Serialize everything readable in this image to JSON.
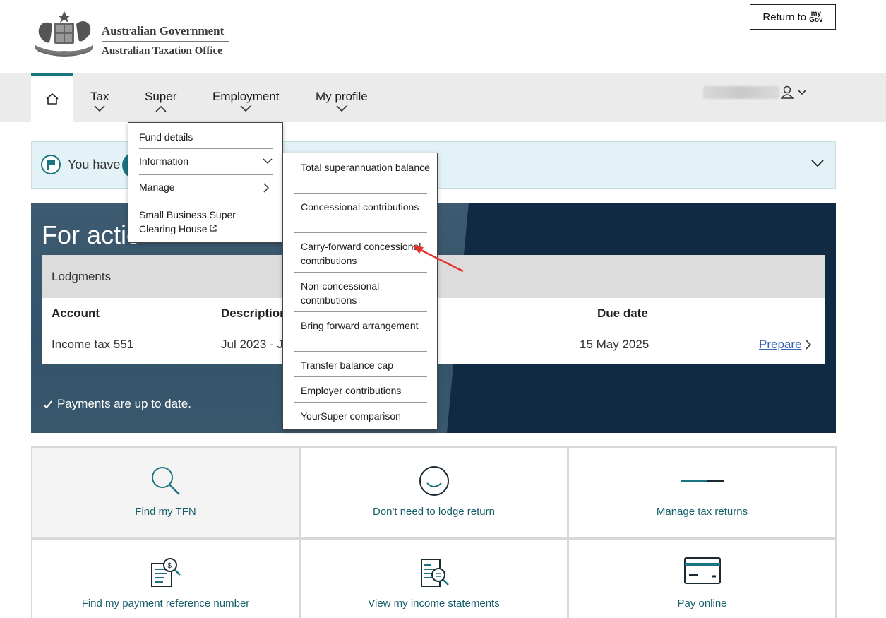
{
  "header": {
    "org_line1": "Australian Government",
    "org_line2": "Australian Taxation Office",
    "return_label": "Return to",
    "mygov_top": "my",
    "mygov_bottom": "Gov"
  },
  "nav": {
    "items": [
      {
        "label": "Tax"
      },
      {
        "label": "Super"
      },
      {
        "label": "Employment"
      },
      {
        "label": "My profile"
      }
    ]
  },
  "notice": {
    "text": "You have"
  },
  "action": {
    "title": "For actio",
    "lodgments_label": "Lodgments",
    "columns": [
      "Account",
      "Description",
      "Due date"
    ],
    "row": {
      "account": "Income tax 551",
      "description": "Jul 2023 - J",
      "due_date": "15 May 2025",
      "action": "Prepare"
    },
    "payment_status": "Payments are up to date."
  },
  "super_menu": {
    "items": [
      {
        "label": "Fund details"
      },
      {
        "label": "Information"
      },
      {
        "label": "Manage"
      },
      {
        "label": "Small Business Super Clearing House"
      }
    ]
  },
  "information_menu": {
    "items": [
      {
        "label": "Total superannuation balance"
      },
      {
        "label": "Concessional contributions"
      },
      {
        "label": "Carry-forward concessional contributions"
      },
      {
        "label": "Non-concessional contributions"
      },
      {
        "label": "Bring forward arrangement"
      },
      {
        "label": "Transfer balance cap"
      },
      {
        "label": "Employer contributions"
      },
      {
        "label": "YourSuper comparison"
      }
    ]
  },
  "tiles": [
    {
      "label": "Find my TFN",
      "icon": "magnifier-icon"
    },
    {
      "label": "Don't need to lodge return",
      "icon": "smile-icon"
    },
    {
      "label": "Manage tax returns",
      "icon": "progress-line-icon"
    },
    {
      "label": "Find my payment reference number",
      "icon": "document-search-icon"
    },
    {
      "label": "View my income statements",
      "icon": "statement-search-icon"
    },
    {
      "label": "Pay online",
      "icon": "card-icon"
    }
  ],
  "colors": {
    "teal": "#1a7481",
    "navy": "#0f2a42",
    "link": "#3a63b8"
  }
}
